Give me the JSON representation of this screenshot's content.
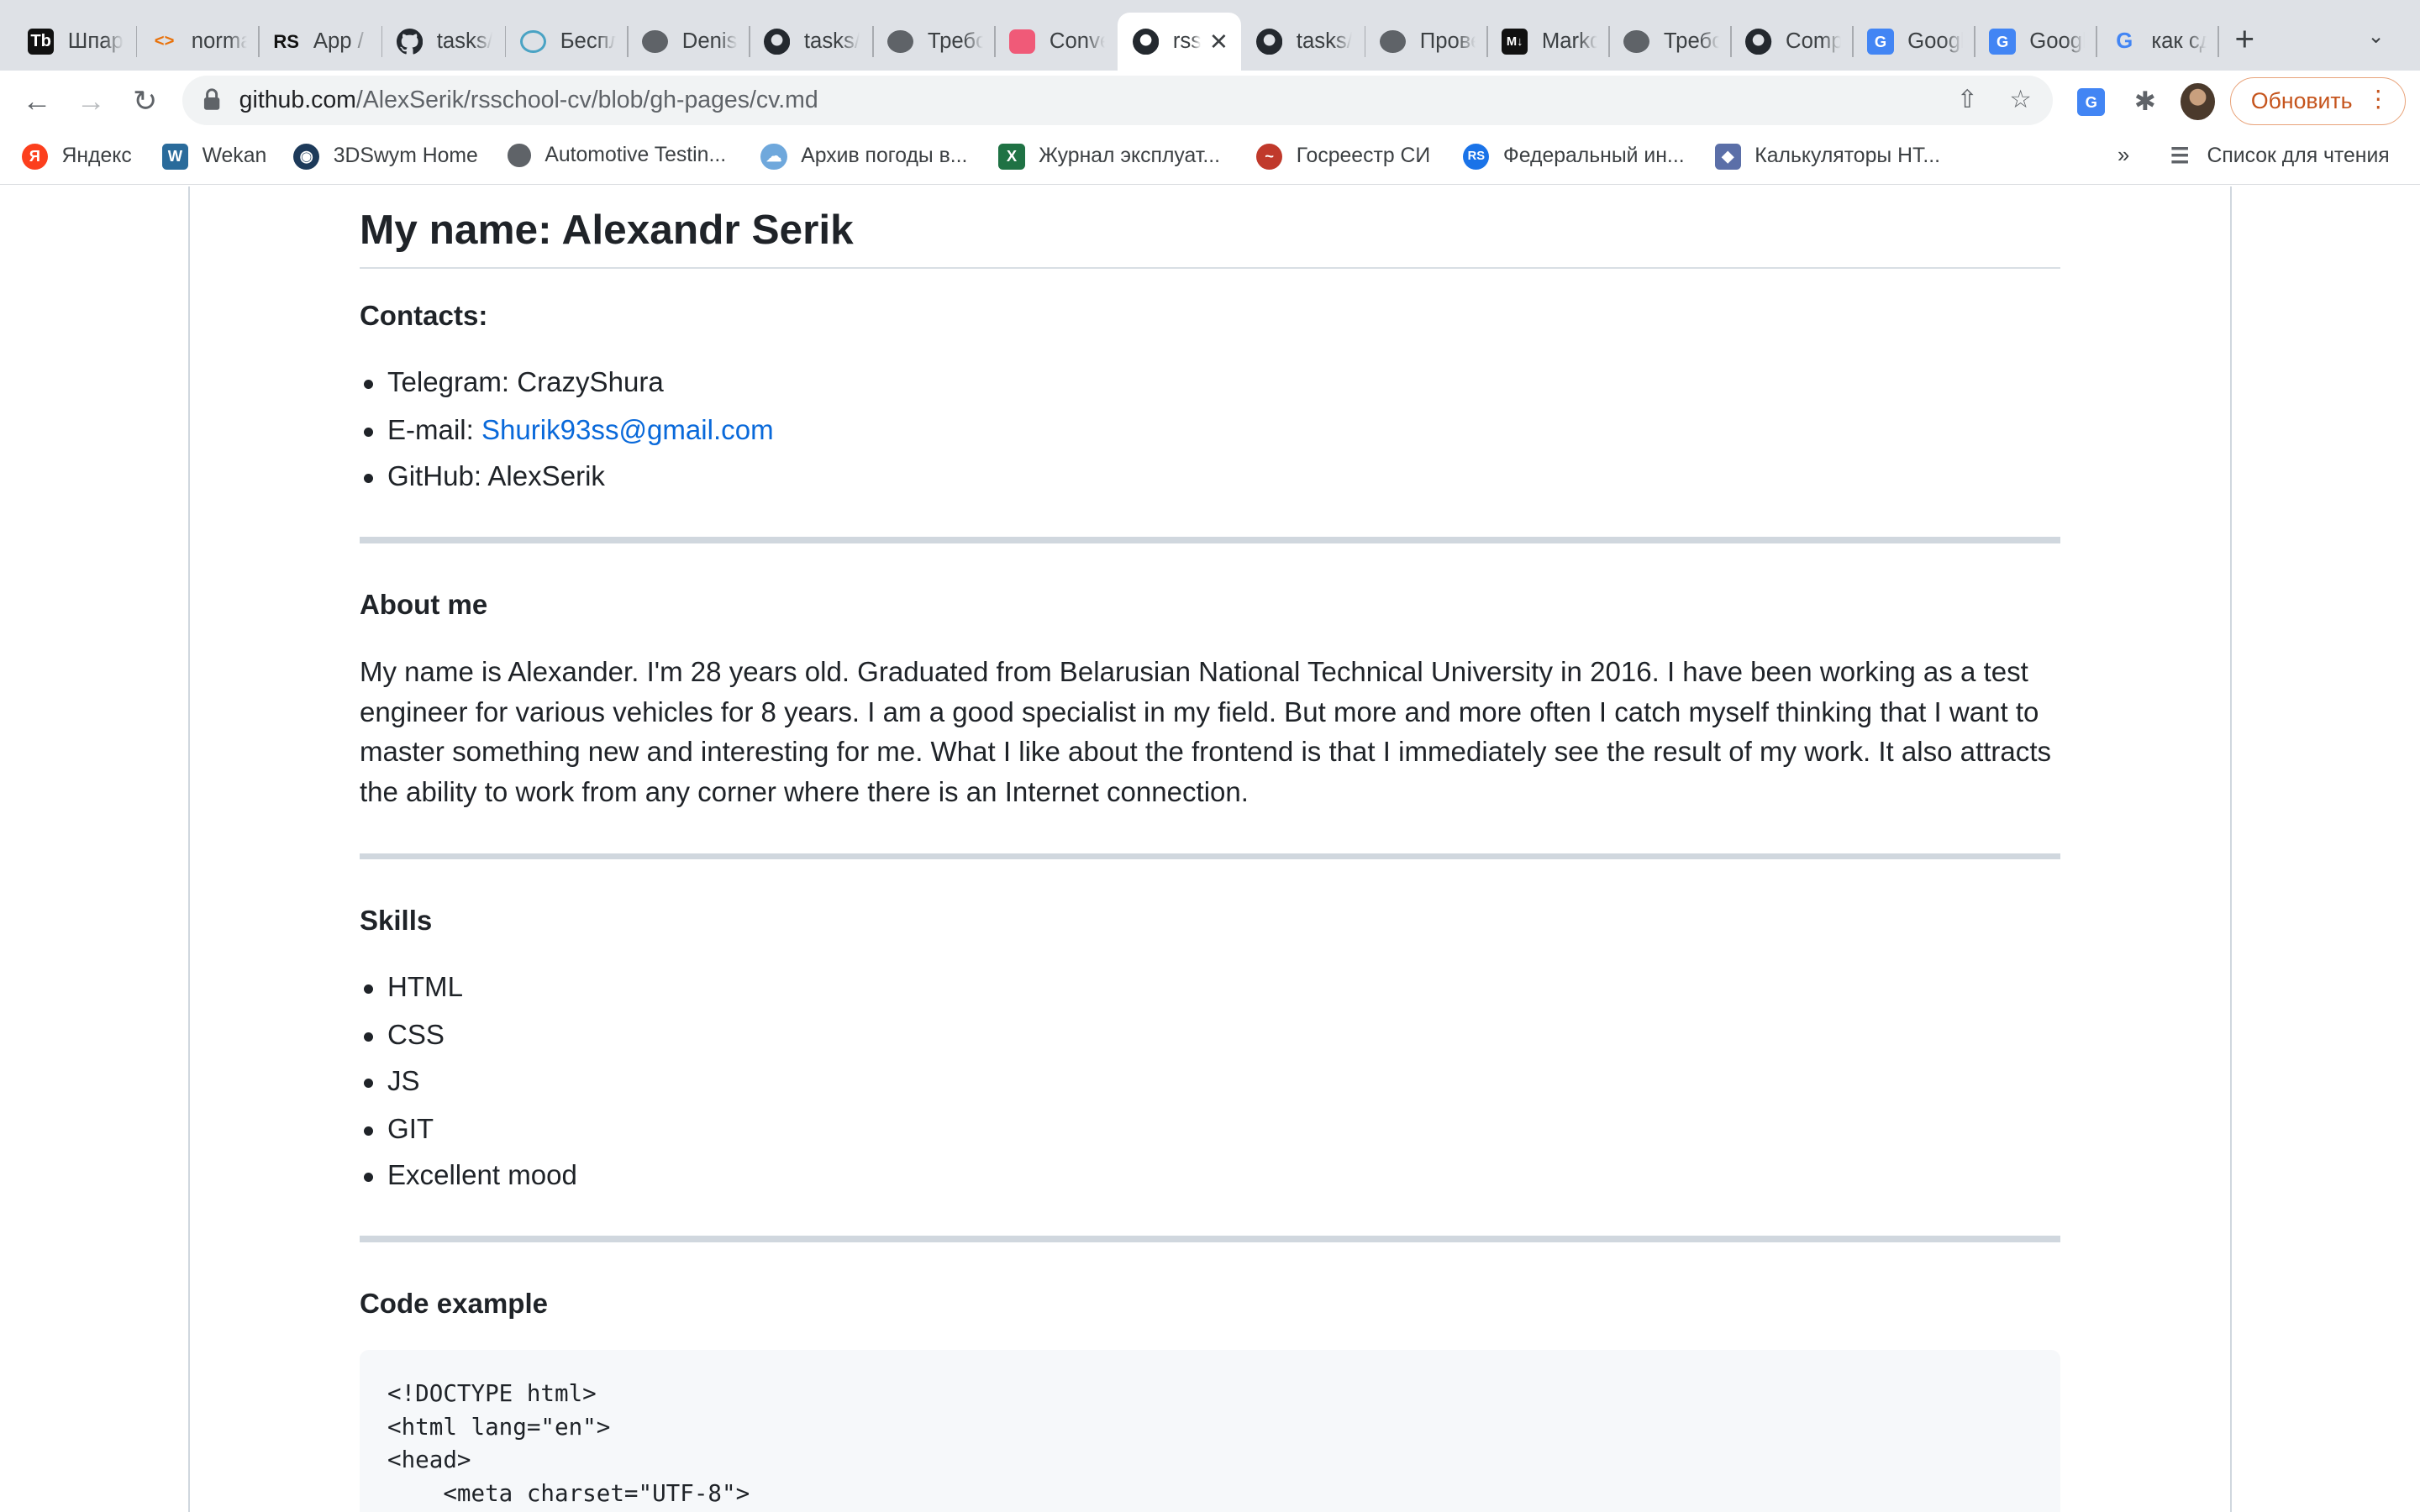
{
  "browser": {
    "tabs": [
      {
        "title": "Шпаргалка",
        "icon": "tb-icon"
      },
      {
        "title": "normalize",
        "icon": "code-icon"
      },
      {
        "title": "App / RS",
        "icon": "rs-icon"
      },
      {
        "title": "tasks/",
        "icon": "github-icon"
      },
      {
        "title": "Бесплатно",
        "icon": "convert-icon"
      },
      {
        "title": "Denis",
        "icon": "globe-icon"
      },
      {
        "title": "tasks/",
        "icon": "github-icon"
      },
      {
        "title": "Требования",
        "icon": "globe-icon"
      },
      {
        "title": "Convert",
        "icon": "pink-square-icon"
      },
      {
        "title": "rsschool",
        "icon": "github-icon",
        "active": true
      },
      {
        "title": "tasks/",
        "icon": "github-icon"
      },
      {
        "title": "Проверка",
        "icon": "globe-icon"
      },
      {
        "title": "Markdown",
        "icon": "markdown-icon"
      },
      {
        "title": "Требования",
        "icon": "globe-icon"
      },
      {
        "title": "Compare",
        "icon": "github-icon"
      },
      {
        "title": "Google",
        "icon": "google-translate-icon"
      },
      {
        "title": "Google",
        "icon": "google-translate-icon"
      },
      {
        "title": "как сделать",
        "icon": "google-icon"
      }
    ],
    "url_host": "github.com",
    "url_path": "/AlexSerik/rsschool-cv/blob/gh-pages/cv.md",
    "update_label": "Обновить",
    "bookmarks": [
      {
        "label": "Яндекс",
        "icon": "yandex-icon"
      },
      {
        "label": "Wekan",
        "icon": "wekan-icon"
      },
      {
        "label": "3DSwym Home",
        "icon": "swym-icon"
      },
      {
        "label": "Automotive Testin...",
        "icon": "globe-icon"
      },
      {
        "label": "Архив погоды в...",
        "icon": "weather-icon"
      },
      {
        "label": "Журнал эксплуат...",
        "icon": "excel-icon"
      },
      {
        "label": "Госреестр СИ",
        "icon": "gosreestr-icon"
      },
      {
        "label": "Федеральный ин...",
        "icon": "fed-icon"
      },
      {
        "label": "Калькуляторы НТ...",
        "icon": "cube-icon"
      }
    ],
    "bookmarks_more": "»",
    "reading_list": "Список для чтения"
  },
  "cv": {
    "title": "My name: Alexandr Serik",
    "contacts_heading": "Contacts:",
    "contacts": {
      "telegram": "Telegram: CrazyShura",
      "email_prefix": "E-mail: ",
      "email": "Shurik93ss@gmail.com",
      "github": "GitHub: AlexSerik"
    },
    "about_heading": "About me",
    "about_text": "My name is Alexander. I'm 28 years old. Graduated from Belarusian National Technical University in 2016. I have been working as a test engineer for various vehicles for 8 years. I am a good specialist in my field. But more and more often I catch myself thinking that I want to master something new and interesting for me. What I like about the frontend is that I immediately see the result of my work. It also attracts the ability to work from any corner where there is an Internet connection.",
    "skills_heading": "Skills",
    "skills": [
      "HTML",
      "CSS",
      "JS",
      "GIT",
      "Excellent mood"
    ],
    "code_heading": "Code example",
    "code_lines": [
      "<!DOCTYPE html>",
      "<html lang=\"en\">",
      "<head>",
      "    <meta charset=\"UTF-8\">"
    ]
  }
}
